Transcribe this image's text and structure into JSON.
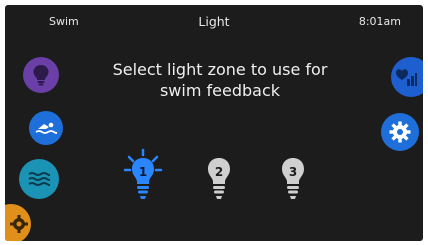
{
  "status_bar": {
    "mode_label": "Swim",
    "title": "Light",
    "time": "8:01am"
  },
  "prompt": {
    "message": "Select light zone to use for swim feedback"
  },
  "left_nav": [
    {
      "name": "light-mode",
      "icon": "bulb-icon",
      "color": "#6a3fa8"
    },
    {
      "name": "swim-mode",
      "icon": "swimmer-icon",
      "color": "#1e6fd9"
    },
    {
      "name": "water-mode",
      "icon": "waves-icon",
      "color": "#1a93b5"
    },
    {
      "name": "settings-partial",
      "icon": "gear-icon",
      "color": "#e0901a"
    }
  ],
  "right_nav": [
    {
      "name": "stats",
      "icon": "heart-chart-icon",
      "color": "#1e5fd0"
    },
    {
      "name": "settings",
      "icon": "gear-icon",
      "color": "#1e6fd9"
    }
  ],
  "zones": [
    {
      "number": "1",
      "selected": true,
      "color": "#2a86ff"
    },
    {
      "number": "2",
      "selected": false,
      "color": "#cfcfcf"
    },
    {
      "number": "3",
      "selected": false,
      "color": "#cfcfcf"
    }
  ]
}
